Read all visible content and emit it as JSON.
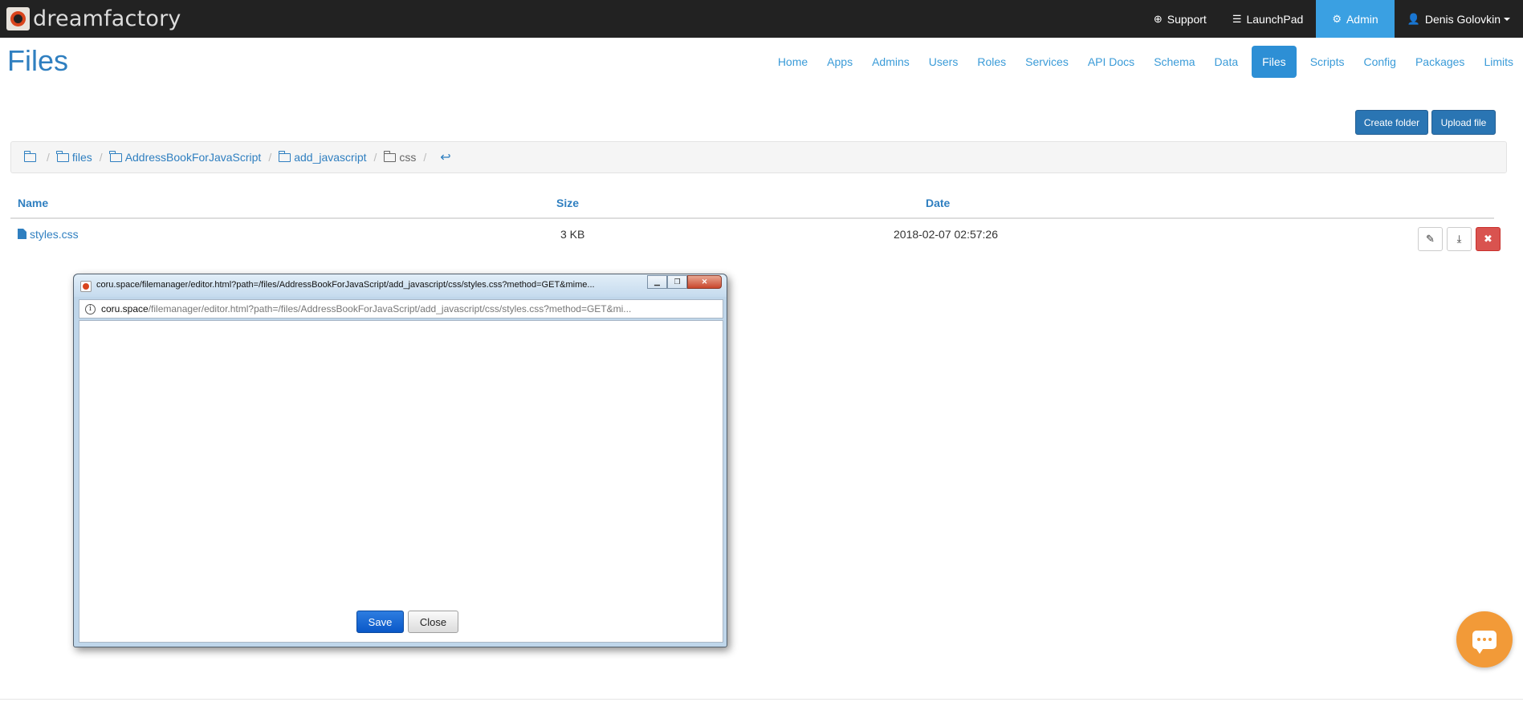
{
  "topbar": {
    "brand": "dreamfactory",
    "support": "Support",
    "launchpad": "LaunchPad",
    "admin": "Admin",
    "user": "Denis Golovkin"
  },
  "page": {
    "title": "Files"
  },
  "subnav": [
    "Home",
    "Apps",
    "Admins",
    "Users",
    "Roles",
    "Services",
    "API Docs",
    "Schema",
    "Data",
    "Files",
    "Scripts",
    "Config",
    "Packages",
    "Limits"
  ],
  "actions": {
    "create_folder": "Create folder",
    "upload_file": "Upload file"
  },
  "breadcrumb": {
    "sep": "/",
    "items": [
      "files",
      "AddressBookForJavaScript",
      "add_javascript",
      "css"
    ]
  },
  "table": {
    "headers": {
      "name": "Name",
      "size": "Size",
      "date": "Date"
    },
    "rows": [
      {
        "name": "styles.css",
        "size": "3 KB",
        "date": "2018-02-07 02:57:26"
      }
    ]
  },
  "popup": {
    "title": "coru.space/filemanager/editor.html?path=/files/AddressBookForJavaScript/add_javascript/css/styles.css?method=GET&mime...",
    "address_host": "coru.space",
    "address_path": "/filemanager/editor.html?path=/files/AddressBookForJavaScript/add_javascript/css/styles.css?method=GET&mi...",
    "save": "Save",
    "close": "Close"
  },
  "colors": {
    "topbar_bg": "#222222",
    "accent": "#3aa0e2",
    "link": "#2f7fc0",
    "primary_button": "#2a75b3",
    "danger": "#d9534f",
    "chat": "#f29a38"
  }
}
